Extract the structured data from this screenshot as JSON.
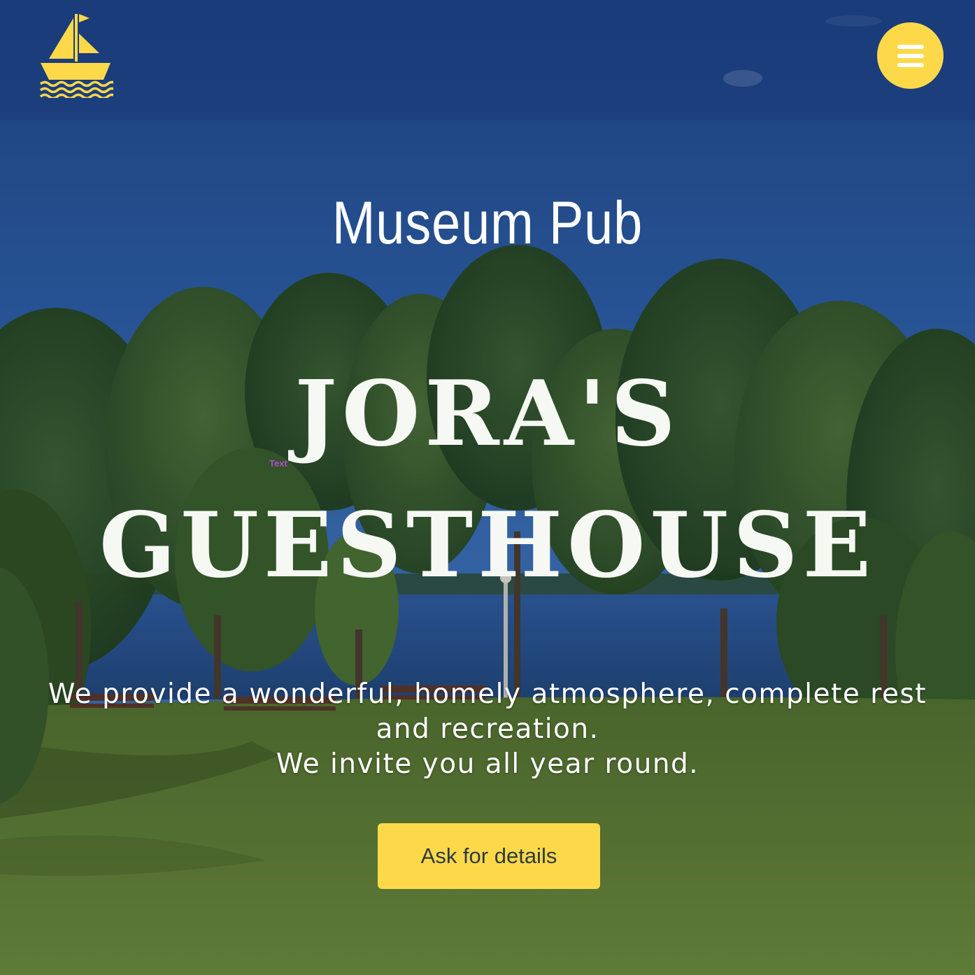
{
  "colors": {
    "accent_yellow": "#fdd94a",
    "header_blue": "#1a3878",
    "title_white": "#f6f8f3",
    "cta_text": "#2e3a3e",
    "tag_purple": "#b64ad8"
  },
  "header": {
    "logo_icon": "sailboat-logo-icon",
    "menu_icon": "hamburger-menu-icon"
  },
  "hero": {
    "pre_title": "Museum Pub",
    "title_line_1": "JORA'S",
    "title_line_2": "GUESTHOUSE",
    "text_tag": "Text",
    "description_line_1": "We provide a wonderful, homely atmosphere, complete rest",
    "description_line_2": "and recreation.",
    "description_line_3": "We invite you all year round.",
    "cta_label": "Ask for details"
  }
}
